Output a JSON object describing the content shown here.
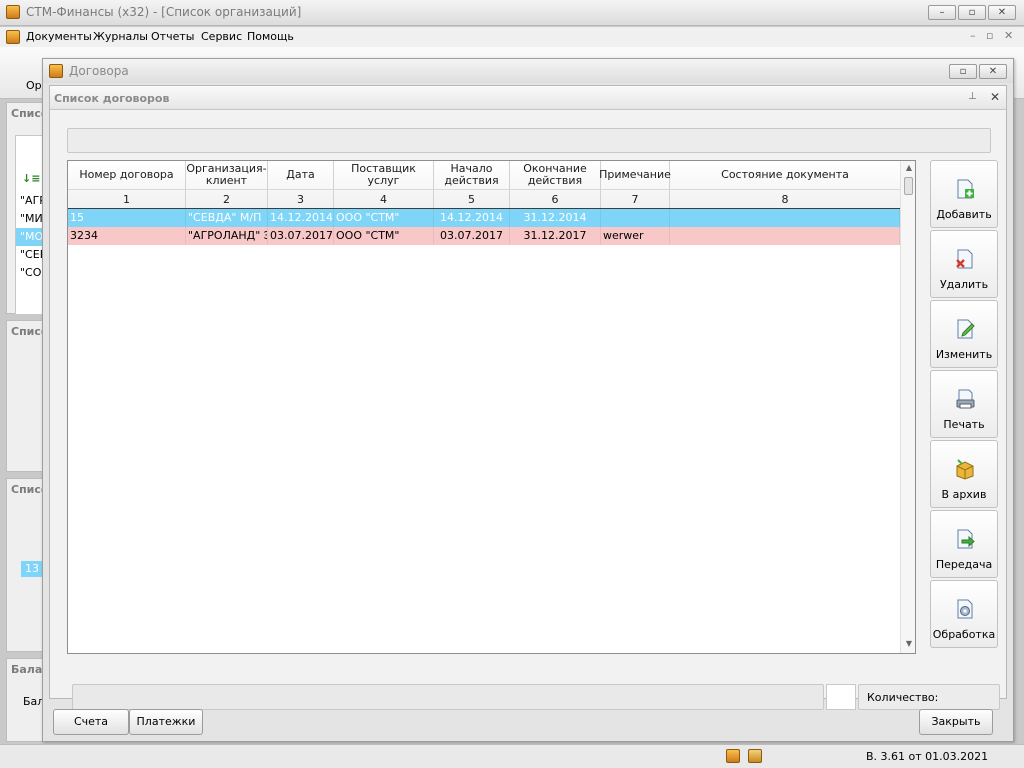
{
  "app": {
    "title": "СТМ-Финансы (x32) - [Список организаций]",
    "window_buttons": {
      "minimize": "–",
      "restore": "▫",
      "close": "✕"
    }
  },
  "menu": [
    "Документы",
    "Журналы",
    "Отчеты",
    "Сервис",
    "Помощь"
  ],
  "ribbon": {
    "first_label": "Ор"
  },
  "left_panes": {
    "pane1_title": "Списо",
    "pane1_items": [
      "\"АГР",
      "\"МИС",
      "\"МОС",
      "\"СЕВ",
      "\"СОВ"
    ],
    "pane2_title": "Списо",
    "pane3_title": "Списо",
    "pane3_value": "13",
    "pane4_title": "Бала",
    "pane4_label": "Бал"
  },
  "dialog": {
    "title": "Договора",
    "panel_title": "Список договоров",
    "pin_glyph": "⊥",
    "close_glyph": "✕"
  },
  "grid": {
    "columns": [
      {
        "label": "Номер договора",
        "num": "1"
      },
      {
        "label": "Организация-клиент",
        "num": "2"
      },
      {
        "label": "Дата",
        "num": "3"
      },
      {
        "label": "Поставщик услуг",
        "num": "4"
      },
      {
        "label": "Начало действия",
        "num": "5"
      },
      {
        "label": "Окончание действия",
        "num": "6"
      },
      {
        "label": "Примечание",
        "num": "7"
      },
      {
        "label": "Состояние документа",
        "num": "8"
      }
    ],
    "rows": [
      [
        "15",
        "\"СЕВДА\" М/П",
        "14.12.2014",
        "ООО \"СТМ\"",
        "14.12.2014",
        "31.12.2014",
        "",
        ""
      ],
      [
        "3234",
        "\"АГРОЛАНД\" ЭН",
        "03.07.2017",
        "ООО \"СТМ\"",
        "03.07.2017",
        "31.12.2017",
        "werwer",
        ""
      ]
    ],
    "selected_row_color": "#7fd5f7",
    "highlight_row_color": "#f8c8c8"
  },
  "side_buttons": [
    "Добавить",
    "Удалить",
    "Изменить",
    "Печать",
    "В архив",
    "Передача",
    "Обработка"
  ],
  "footer": {
    "count_label": "Количество:"
  },
  "bottom_buttons": {
    "accounts": "Счета",
    "payments": "Платежки",
    "close": "Закрыть"
  },
  "statusbar": {
    "version": "В. 3.61 от 01.03.2021"
  }
}
